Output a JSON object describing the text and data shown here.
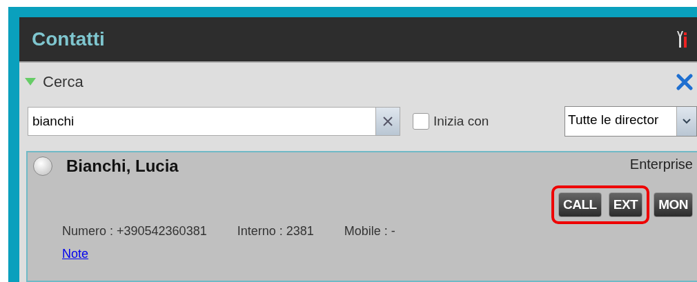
{
  "header": {
    "title": "Contatti"
  },
  "search_section": {
    "title": "Cerca",
    "expanded": true
  },
  "search": {
    "value": "bianchi",
    "starts_with": {
      "label": "Inizia con",
      "checked": false
    },
    "directory": "Tutte le director"
  },
  "contacts": [
    {
      "name": "Bianchi, Lucia",
      "selected": false,
      "directory": "Enterprise",
      "buttons": [
        {
          "label": "CALL",
          "highlighted": true
        },
        {
          "label": "EXT",
          "highlighted": true
        },
        {
          "label": "MON",
          "highlighted": false
        }
      ],
      "fields": [
        "Numero : +390542360381",
        "Interno : 2381",
        "Mobile : -"
      ],
      "link": "Note"
    }
  ]
}
